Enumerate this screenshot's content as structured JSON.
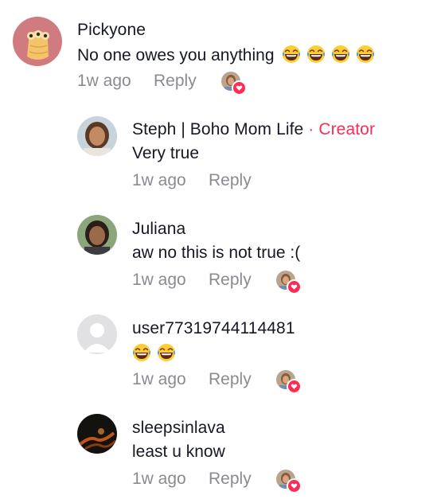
{
  "comments": [
    {
      "username": "Pickyone",
      "text": "No one owes you anything",
      "emoji_count": 4,
      "emoji": "laughing-tears-emoji",
      "time": "1w ago",
      "reply_label": "Reply",
      "liked_by_creator": true
    },
    {
      "username": "Steph | Boho Mom Life",
      "creator_separator": "·",
      "creator_label": "Creator",
      "text": "Very true",
      "time": "1w ago",
      "reply_label": "Reply",
      "liked_by_creator": false
    },
    {
      "username": "Juliana",
      "text": "aw no this is not true :(",
      "time": "1w ago",
      "reply_label": "Reply",
      "liked_by_creator": true
    },
    {
      "username": "user77319744114481",
      "text": "",
      "emoji_count": 2,
      "emoji": "laughing-tears-emoji",
      "time": "1w ago",
      "reply_label": "Reply",
      "liked_by_creator": true
    },
    {
      "username": "sleepsinlava",
      "text": "least u know",
      "time": "1w ago",
      "reply_label": "Reply",
      "liked_by_creator": true
    }
  ],
  "colors": {
    "creator_accent": "#fe2c55",
    "meta_gray": "#8a8b91",
    "text": "#161823"
  }
}
